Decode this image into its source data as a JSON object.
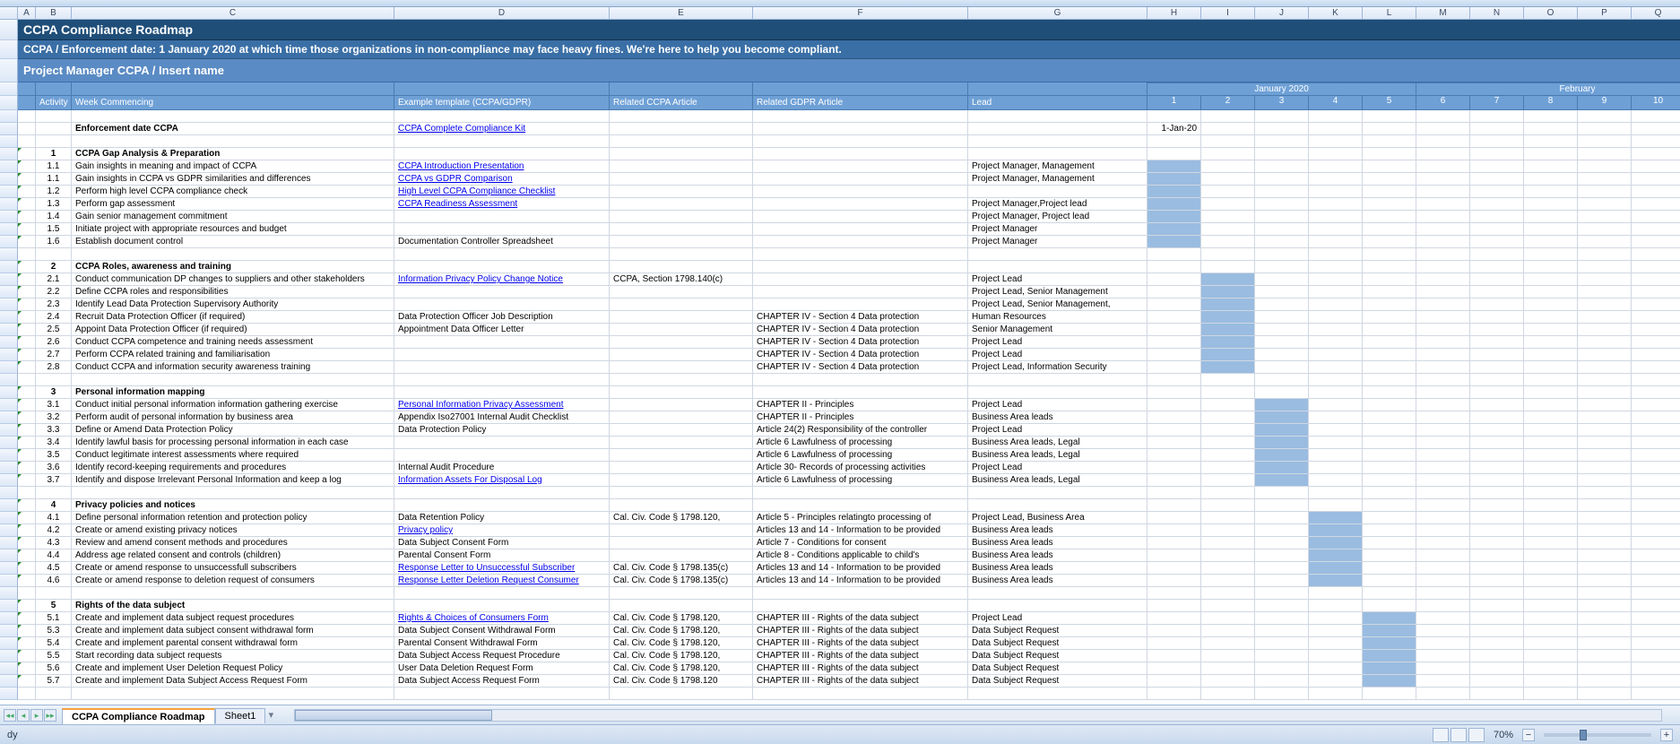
{
  "columns": [
    "A",
    "B",
    "C",
    "D",
    "E",
    "F",
    "G",
    "H",
    "I",
    "J",
    "K",
    "L",
    "M",
    "N",
    "O",
    "P",
    "Q"
  ],
  "title": "CCPA Compliance Roadmap",
  "subtitle": "CCPA / Enforcement date: 1 January 2020 at which time those organizations in non-compliance may face heavy fines. We're here to help you become compliant.",
  "pm_row": "Project Manager CCPA / Insert name",
  "headers": {
    "activity": "Activity",
    "week_commencing": "Week Commencing",
    "example_template": "Example template (CCPA/GDPR)",
    "related_ccpa": "Related CCPA Article",
    "related_gdpr": "Related GDPR Article",
    "lead": "Lead",
    "month1": "January 2020",
    "month2": "February",
    "weeks": [
      "1",
      "2",
      "3",
      "4",
      "5",
      "6",
      "7",
      "8",
      "9",
      "10",
      "1"
    ]
  },
  "enforcement_label": "Enforcement date CCPA",
  "enforcement_link": "CCPA Complete Compliance Kit",
  "enforcement_date": "1-Jan-20",
  "sections": [
    {
      "num": "1",
      "title": "CCPA Gap Analysis & Preparation",
      "rows": [
        {
          "id": "1.1",
          "desc": "Gain insights in meaning and impact of CCPA",
          "tpl": "CCPA Introduction Presentation",
          "link": true,
          "ccpa": "",
          "gdpr": "",
          "lead": "Project Manager, Management",
          "g": [
            0
          ]
        },
        {
          "id": "1.1",
          "desc": "Gain insights in CCPA vs GDPR similarities and differences",
          "tpl": "CCPA vs GDPR Comparison",
          "link": true,
          "ccpa": "",
          "gdpr": "",
          "lead": "Project Manager, Management",
          "g": [
            0
          ]
        },
        {
          "id": "1.2",
          "desc": "Perform high level CCPA compliance check",
          "tpl": "High Level CCPA Compliance Checklist",
          "link": true,
          "ccpa": "",
          "gdpr": "",
          "lead": "",
          "g": [
            0
          ]
        },
        {
          "id": "1.3",
          "desc": "Perform gap assessment",
          "tpl": "CCPA Readiness Assessment",
          "link": true,
          "ccpa": "",
          "gdpr": "",
          "lead": "Project Manager,Project lead",
          "g": [
            0
          ]
        },
        {
          "id": "1.4",
          "desc": "Gain senior management commitment",
          "tpl": "",
          "link": false,
          "ccpa": "",
          "gdpr": "",
          "lead": "Project Manager, Project lead",
          "g": [
            0
          ]
        },
        {
          "id": "1.5",
          "desc": "Initiate project with appropriate resources and budget",
          "tpl": "",
          "link": false,
          "ccpa": "",
          "gdpr": "",
          "lead": "Project Manager",
          "g": [
            0
          ]
        },
        {
          "id": "1.6",
          "desc": "Establish document control",
          "tpl": "Documentation Controller Spreadsheet",
          "link": false,
          "ccpa": "",
          "gdpr": "",
          "lead": "Project Manager",
          "g": [
            0
          ]
        }
      ]
    },
    {
      "num": "2",
      "title": "CCPA Roles, awareness and training",
      "rows": [
        {
          "id": "2.1",
          "desc": "Conduct communication DP changes to suppliers and other stakeholders",
          "tpl": "Information Privacy Policy Change Notice",
          "link": true,
          "ccpa": "CCPA, Section 1798.140(c)",
          "gdpr": "",
          "lead": "Project Lead",
          "g": [
            1
          ]
        },
        {
          "id": "2.2",
          "desc": "Define CCPA roles and responsibilities",
          "tpl": "",
          "link": false,
          "ccpa": "",
          "gdpr": "",
          "lead": "Project Lead, Senior Management",
          "g": [
            1
          ]
        },
        {
          "id": "2.3",
          "desc": "Identify Lead Data Protection Supervisory Authority",
          "tpl": "",
          "link": false,
          "ccpa": "",
          "gdpr": "",
          "lead": "Project Lead, Senior Management,",
          "g": [
            1
          ]
        },
        {
          "id": "2.4",
          "desc": "Recruit Data Protection Officer (if required)",
          "tpl": "Data Protection Officer Job Description",
          "link": false,
          "ccpa": "",
          "gdpr": "CHAPTER IV -  Section 4 Data protection",
          "lead": "Human Resources",
          "g": [
            1
          ]
        },
        {
          "id": "2.5",
          "desc": "Appoint Data Protection Officer (if required)",
          "tpl": "Appointment Data Officer Letter",
          "link": false,
          "ccpa": "",
          "gdpr": "CHAPTER IV -  Section 4 Data protection",
          "lead": "Senior Management",
          "g": [
            1
          ]
        },
        {
          "id": "2.6",
          "desc": "Conduct CCPA competence and training needs assessment",
          "tpl": "",
          "link": false,
          "ccpa": "",
          "gdpr": "CHAPTER IV -  Section 4 Data protection",
          "lead": "Project Lead",
          "g": [
            1
          ]
        },
        {
          "id": "2.7",
          "desc": "Perform CCPA related training and familiarisation",
          "tpl": "",
          "link": false,
          "ccpa": "",
          "gdpr": "CHAPTER IV -  Section 4 Data protection",
          "lead": "Project Lead",
          "g": [
            1
          ]
        },
        {
          "id": "2.8",
          "desc": "Conduct CCPA and information security awareness training",
          "tpl": "",
          "link": false,
          "ccpa": "",
          "gdpr": "CHAPTER IV -  Section 4 Data protection",
          "lead": "Project Lead, Information Security",
          "g": [
            1
          ]
        }
      ]
    },
    {
      "num": "3",
      "title": "Personal information mapping",
      "rows": [
        {
          "id": "3.1",
          "desc": "Conduct initial personal information information gathering exercise",
          "tpl": "Personal Information Privacy Assessment",
          "link": true,
          "ccpa": "",
          "gdpr": "CHAPTER II - Principles",
          "lead": "Project Lead",
          "g": [
            2
          ]
        },
        {
          "id": "3.2",
          "desc": "Perform audit of personal information by business area",
          "tpl": "Appendix Iso27001 Internal Audit Checklist",
          "link": false,
          "ccpa": "",
          "gdpr": "CHAPTER II - Principles",
          "lead": "Business Area leads",
          "g": [
            2
          ]
        },
        {
          "id": "3.3",
          "desc": "Define or Amend Data Protection Policy",
          "tpl": "Data Protection Policy",
          "link": false,
          "ccpa": "",
          "gdpr": "Article 24(2) Responsibility of the controller",
          "lead": "Project Lead",
          "g": [
            2
          ]
        },
        {
          "id": "3.4",
          "desc": "Identify lawful basis for processing personal information in each case",
          "tpl": "",
          "link": false,
          "ccpa": "",
          "gdpr": "Article 6 Lawfulness of processing",
          "lead": "Business Area leads, Legal",
          "g": [
            2
          ]
        },
        {
          "id": "3.5",
          "desc": "Conduct legitimate interest assessments where required",
          "tpl": "",
          "link": false,
          "ccpa": "",
          "gdpr": "Article 6 Lawfulness of processing",
          "lead": "Business Area leads, Legal",
          "g": [
            2
          ]
        },
        {
          "id": "3.6",
          "desc": "Identify record-keeping requirements and procedures",
          "tpl": "Internal Audit Procedure",
          "link": false,
          "ccpa": "",
          "gdpr": "Article 30- Records of processing activities",
          "lead": "Project Lead",
          "g": [
            2
          ]
        },
        {
          "id": "3.7",
          "desc": "Identify and dispose Irrelevant Personal Information and keep a log",
          "tpl": "Information Assets For Disposal Log",
          "link": true,
          "ccpa": "",
          "gdpr": "Article 6 Lawfulness of processing",
          "lead": "Business Area leads, Legal",
          "g": [
            2
          ]
        }
      ]
    },
    {
      "num": "4",
      "title": "Privacy policies and notices",
      "rows": [
        {
          "id": "4.1",
          "desc": "Define personal information retention and protection policy",
          "tpl": "Data Retention Policy",
          "link": false,
          "ccpa": "Cal. Civ. Code § 1798.120,",
          "gdpr": "Article 5 - Principles relatingto processing of",
          "lead": "Project Lead, Business Area",
          "g": [
            3
          ]
        },
        {
          "id": "4.2",
          "desc": "Create or amend existing privacy notices",
          "tpl": "Privacy policy",
          "link": true,
          "ccpa": "",
          "gdpr": "Articles 13 and 14 - Information to be provided",
          "lead": "Business Area leads",
          "g": [
            3
          ]
        },
        {
          "id": "4.3",
          "desc": "Review and amend consent methods and procedures",
          "tpl": "Data Subject Consent Form",
          "link": false,
          "ccpa": "",
          "gdpr": "Article 7 -  Conditions for consent",
          "lead": "Business Area leads",
          "g": [
            3
          ]
        },
        {
          "id": "4.4",
          "desc": "Address age related consent and controls (children)",
          "tpl": "Parental Consent Form",
          "link": false,
          "ccpa": "",
          "gdpr": "Article 8 - Conditions applicable to child's",
          "lead": "Business Area leads",
          "g": [
            3
          ]
        },
        {
          "id": "4.5",
          "desc": "Create or amend response to unsuccessfull subscribers",
          "tpl": "Response Letter to Unsuccessful Subscriber",
          "link": true,
          "ccpa": "Cal. Civ. Code § 1798.135(c)",
          "gdpr": "Articles 13 and 14 - Information to be provided",
          "lead": "Business Area leads",
          "g": [
            3
          ]
        },
        {
          "id": "4.6",
          "desc": "Create or amend response to deletion request of consumers",
          "tpl": "Response Letter Deletion Request Consumer",
          "link": true,
          "ccpa": "Cal. Civ. Code § 1798.135(c)",
          "gdpr": "Articles 13 and 14 - Information to be provided",
          "lead": "Business Area leads",
          "g": [
            3
          ]
        }
      ]
    },
    {
      "num": "5",
      "title": "Rights of the data subject",
      "rows": [
        {
          "id": "5.1",
          "desc": "Create and implement data subject request procedures",
          "tpl": "Rights & Choices of Consumers Form",
          "link": true,
          "ccpa": "Cal. Civ. Code § 1798.120,",
          "gdpr": "CHAPTER III - Rights of the data subject",
          "lead": "Project Lead",
          "g": [
            4
          ]
        },
        {
          "id": "5.3",
          "desc": "Create and implement data subject consent withdrawal form",
          "tpl": "Data Subject Consent Withdrawal Form",
          "link": false,
          "ccpa": "Cal. Civ. Code § 1798.120,",
          "gdpr": "CHAPTER III - Rights of the data subject",
          "lead": "Data Subject Request",
          "g": [
            4
          ]
        },
        {
          "id": "5.4",
          "desc": "Create and implement parental consent withdrawal form",
          "tpl": "Parental Consent Withdrawal Form",
          "link": false,
          "ccpa": "Cal. Civ. Code § 1798.120,",
          "gdpr": "CHAPTER III - Rights of the data subject",
          "lead": "Data Subject Request",
          "g": [
            4
          ]
        },
        {
          "id": "5.5",
          "desc": "Start recording data subject requests",
          "tpl": "Data Subject Access Request Procedure",
          "link": false,
          "ccpa": "Cal. Civ. Code § 1798.120,",
          "gdpr": "CHAPTER III - Rights of the data subject",
          "lead": "Data Subject Request",
          "g": [
            4
          ]
        },
        {
          "id": "5.6",
          "desc": "Create and implement User Deletion Request Policy",
          "tpl": "User Data Deletion Request Form",
          "link": false,
          "ccpa": "Cal. Civ. Code § 1798.120,",
          "gdpr": "CHAPTER III - Rights of the data subject",
          "lead": "Data Subject Request",
          "g": [
            4
          ]
        },
        {
          "id": "5.7",
          "desc": "Create and implement Data Subject Access Request Form",
          "tpl": "Data Subject Access Request Form",
          "link": false,
          "ccpa": "Cal. Civ. Code § 1798.120",
          "gdpr": "CHAPTER III - Rights of the data subject",
          "lead": "Data Subject Request",
          "g": [
            4
          ]
        }
      ]
    }
  ],
  "tabs": {
    "active": "CCPA Compliance Roadmap",
    "others": [
      "Sheet1"
    ]
  },
  "status": {
    "ready": "dy",
    "zoom": "70%"
  }
}
